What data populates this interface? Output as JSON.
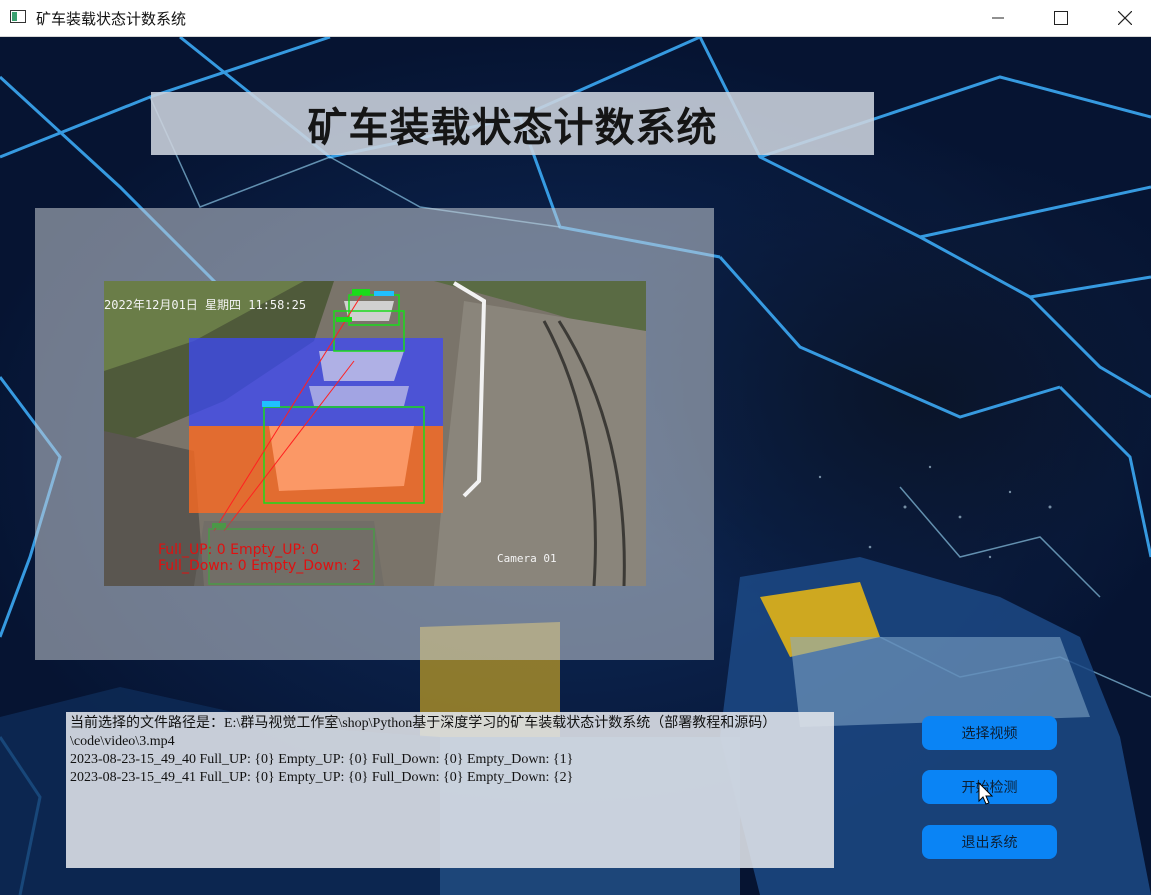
{
  "window": {
    "title": "矿车装载状态计数系统",
    "icon": "app-window-icon",
    "controls": [
      "minimize-icon",
      "maximize-icon",
      "close-icon"
    ]
  },
  "header": {
    "title": "矿车装载状态计数系统"
  },
  "video": {
    "timestamp": "2022年12月01日 星期四 11:58:25",
    "count_up": "Full_UP: 0 Empty_UP: 0",
    "count_down": "Full_Down: 0 Empty_Down: 2",
    "camera_label": "Camera 01",
    "region_colors": {
      "upper": "#3a46ff",
      "lower": "#ff6a20"
    }
  },
  "log": {
    "lines": [
      "当前选择的文件路径是：E:\\群马视觉工作室\\shop\\Python基于深度学习的矿车装载状态计数系统（部署教程和源码）\\code\\video\\3.mp4",
      "2023-08-23-15_49_40 Full_UP: {0} Empty_UP: {0} Full_Down: {0} Empty_Down: {1}",
      "2023-08-23-15_49_41 Full_UP: {0} Empty_UP: {0} Full_Down: {0} Empty_Down: {2}"
    ]
  },
  "buttons": {
    "select_video": "选择视频",
    "start_detect": "开始检测",
    "exit_system": "退出系统"
  },
  "colors": {
    "button_bg": "#0a84f5",
    "background": "#0a1f46"
  }
}
